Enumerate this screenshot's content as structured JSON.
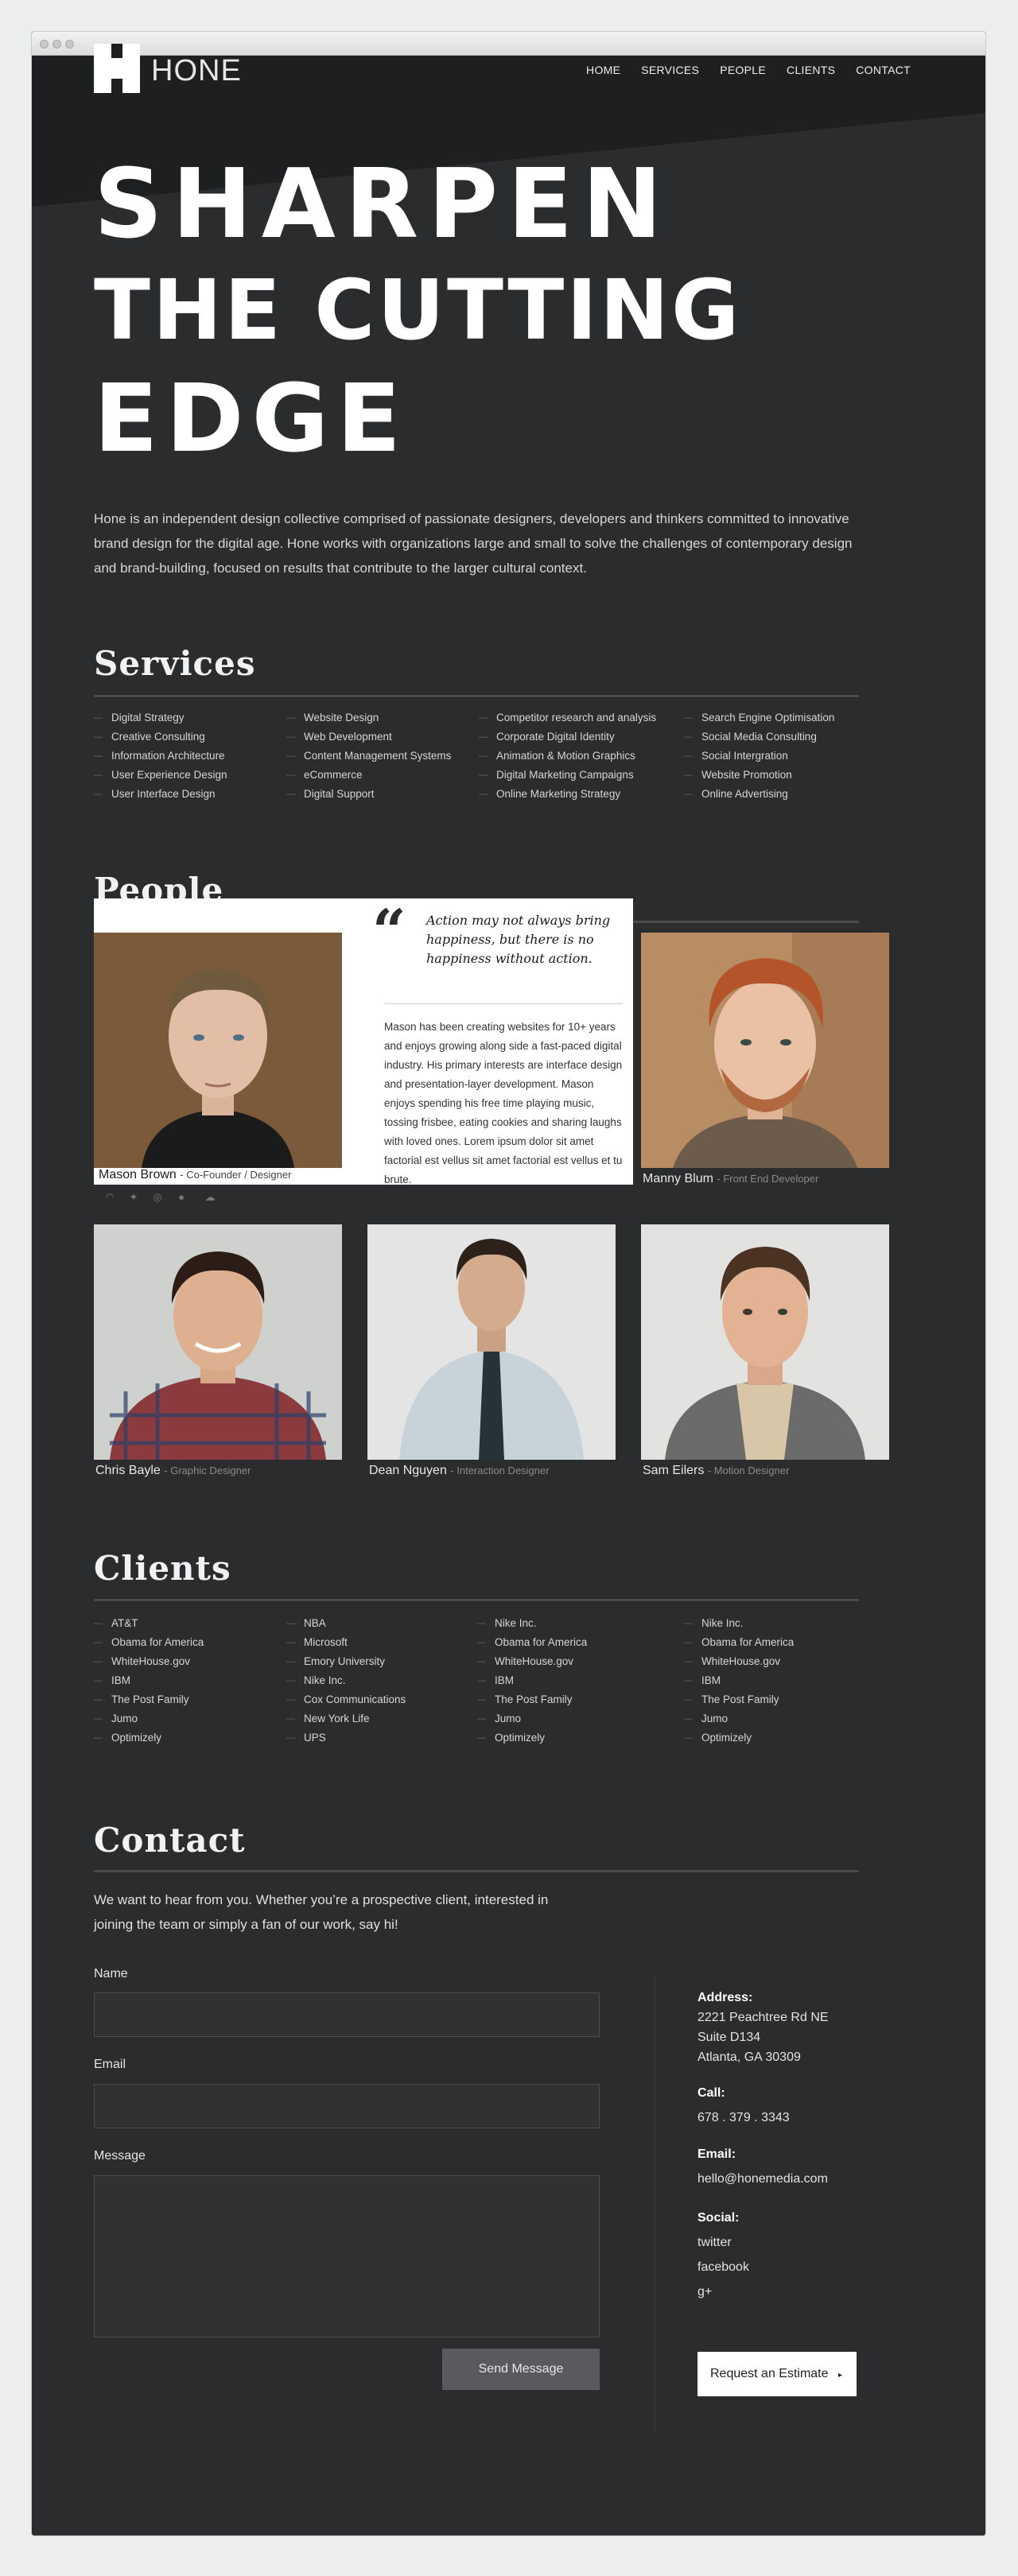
{
  "header": {
    "logo_text": "HONE",
    "nav": [
      "HOME",
      "SERVICES",
      "PEOPLE",
      "CLIENTS",
      "CONTACT"
    ]
  },
  "hero": {
    "lines": [
      "SHARPEN",
      "THE CUTTING",
      "EDGE"
    ]
  },
  "intro": "Hone is an independent design collective comprised of passionate designers, developers and thinkers committed to innovative brand design for the digital age. Hone works with organizations large and small to solve the challenges of contemporary design and brand-building, focused on results that contribute to the larger cultural context.",
  "services": {
    "title": "Services",
    "columns": [
      [
        "Digital Strategy",
        "Creative Consulting",
        "Information Architecture",
        "User Experience Design",
        "User Interface Design"
      ],
      [
        "Website Design",
        "Web Development",
        "Content Management Systems",
        "eCommerce",
        "Digital Support"
      ],
      [
        "Competitor research and analysis",
        "Corporate Digital Identity",
        "Animation & Motion Graphics",
        "Digital Marketing Campaigns",
        "Online Marketing Strategy"
      ],
      [
        "Search Engine Optimisation",
        "Social Media Consulting",
        "Social Intergration",
        "Website Promotion",
        "Online Advertising"
      ]
    ]
  },
  "people": {
    "title": "People",
    "quote": "Action may not always bring happiness, but there is no happiness without action.",
    "bio": "Mason has been creating websites for 10+ years and enjoys growing along side a fast-paced digital industry. His primary interests are interface design and presentation-layer development. Mason enjoys spending his free time playing music, tossing frisbee, eating cookies and sharing laughs with loved ones. Lorem ipsum dolor sit amet factorial est vellus sit amet factorial est vellus et tu brute.",
    "featured": {
      "name": "Mason Brown",
      "role": "- Co-Founder / Designer"
    },
    "members": [
      {
        "name": "Manny Blum",
        "role": "- Front End Developer"
      },
      {
        "name": "Chris Bayle",
        "role": "- Graphic Designer"
      },
      {
        "name": "Dean Nguyen",
        "role": "- Interaction Designer"
      },
      {
        "name": "Sam Eilers",
        "role": "- Motion Designer"
      }
    ]
  },
  "clients": {
    "title": "Clients",
    "columns": [
      [
        "AT&T",
        "Obama for America",
        "WhiteHouse.gov",
        "IBM",
        "The Post Family",
        "Jumo",
        "Optimizely"
      ],
      [
        "NBA",
        "Microsoft",
        "Emory University",
        "Nike Inc.",
        "Cox Communications",
        "New York Life",
        "UPS"
      ],
      [
        "Nike Inc.",
        "Obama for America",
        "WhiteHouse.gov",
        "IBM",
        "The Post Family",
        "Jumo",
        "Optimizely"
      ],
      [
        "Nike Inc.",
        "Obama for America",
        "WhiteHouse.gov",
        "IBM",
        "The Post Family",
        "Jumo",
        "Optimizely"
      ]
    ]
  },
  "contact": {
    "title": "Contact",
    "intro": "We want to hear from you. Whether you’re a prospective client, interested in joining the team or simply a fan of our work, say hi!",
    "name_label": "Name",
    "email_label": "Email",
    "message_label": "Message",
    "send_label": "Send Message",
    "address_label": "Address:",
    "address_lines": [
      "2221 Peachtree Rd NE",
      "Suite D134",
      "Atlanta, GA 30309"
    ],
    "call_label": "Call:",
    "phone": "678 . 379 . 3343",
    "email_info_label": "Email:",
    "email": "hello@honemedia.com",
    "social_label": "Social:",
    "social_links": [
      "twitter",
      "facebook",
      "g+"
    ],
    "estimate_label": "Request an Estimate",
    "estimate_arrow": "▸"
  },
  "icons": [
    "rss-icon",
    "twitter-icon",
    "dribbble-icon",
    "github-icon",
    "soundcloud-icon"
  ]
}
